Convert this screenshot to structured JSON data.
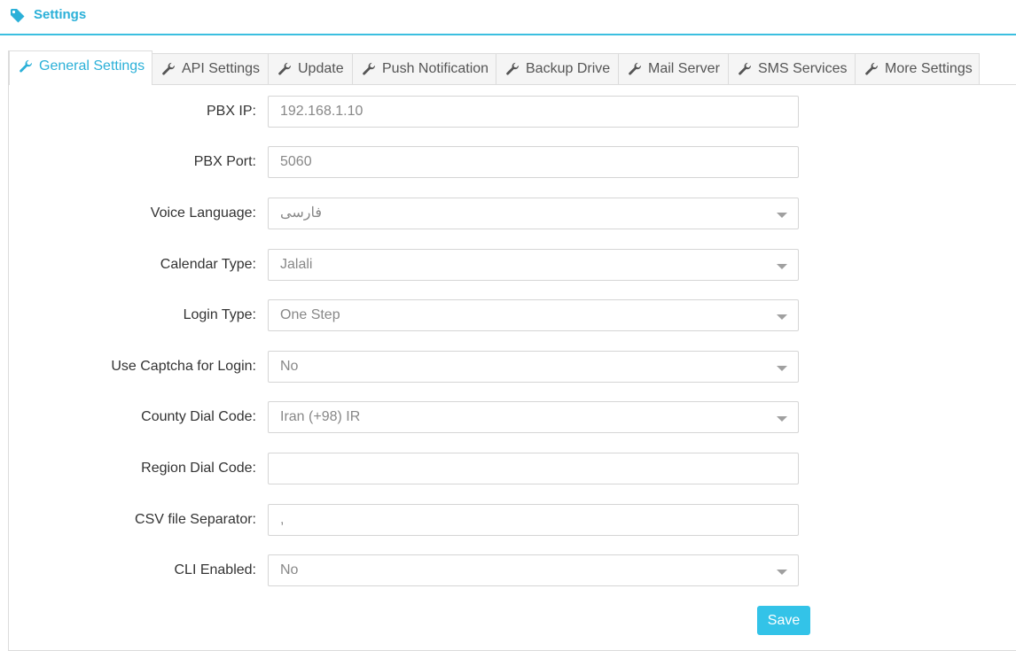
{
  "header": {
    "title": "Settings",
    "icon": "tag-icon",
    "accent": "#2bb0d8"
  },
  "tabs": [
    {
      "label": "General Settings",
      "icon": "wrench-icon",
      "active": true
    },
    {
      "label": "API Settings",
      "icon": "wrench-icon"
    },
    {
      "label": "Update",
      "icon": "wrench-icon"
    },
    {
      "label": "Push Notification",
      "icon": "wrench-icon"
    },
    {
      "label": "Backup Drive",
      "icon": "wrench-icon"
    },
    {
      "label": "Mail Server",
      "icon": "wrench-icon"
    },
    {
      "label": "SMS Services",
      "icon": "wrench-icon"
    },
    {
      "label": "More Settings",
      "icon": "wrench-icon"
    }
  ],
  "form": {
    "pbx_ip": {
      "label": "PBX IP:",
      "value": "192.168.1.10"
    },
    "pbx_port": {
      "label": "PBX Port:",
      "value": "5060"
    },
    "voice_language": {
      "label": "Voice Language:",
      "value": "فارسی"
    },
    "calendar_type": {
      "label": "Calendar Type:",
      "value": "Jalali"
    },
    "login_type": {
      "label": "Login Type:",
      "value": "One Step"
    },
    "use_captcha": {
      "label": "Use Captcha for Login:",
      "value": "No"
    },
    "country_dial_code": {
      "label": "County Dial Code:",
      "value": "Iran (+98) IR"
    },
    "region_dial_code": {
      "label": "Region Dial Code:",
      "value": ""
    },
    "csv_separator": {
      "label": "CSV file Separator:",
      "value": ","
    },
    "cli_enabled": {
      "label": "CLI Enabled:",
      "value": "No"
    }
  },
  "actions": {
    "save_label": "Save",
    "save_color": "#33c3e8"
  }
}
